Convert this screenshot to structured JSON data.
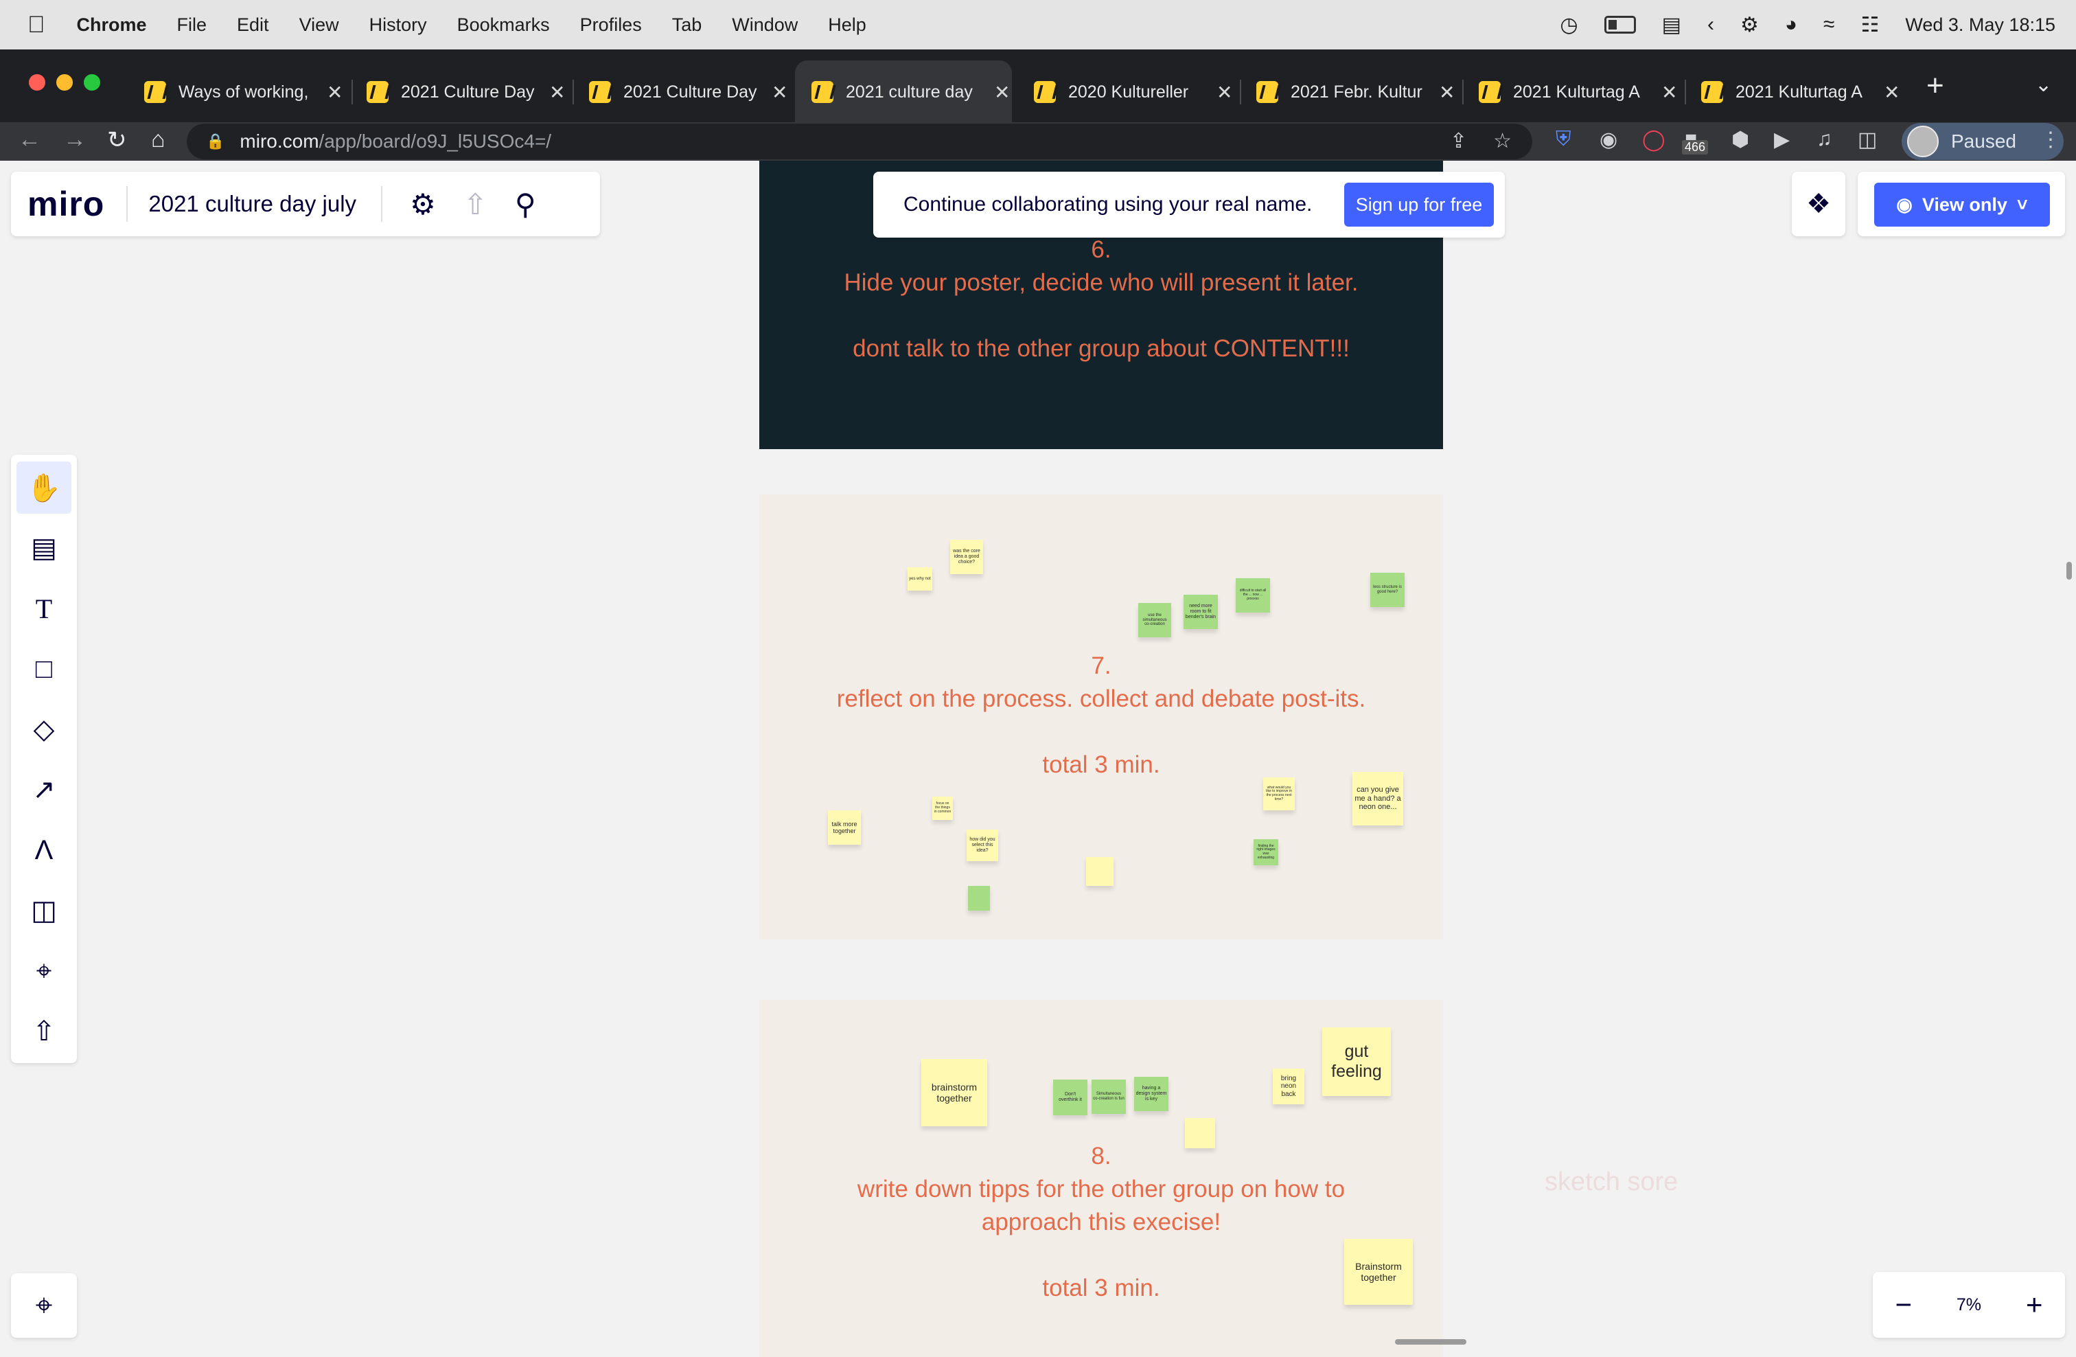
{
  "menubar": {
    "app": "Chrome",
    "items": [
      "File",
      "Edit",
      "View",
      "History",
      "Bookmarks",
      "Profiles",
      "Tab",
      "Window",
      "Help"
    ],
    "clock": "Wed 3. May  18:15"
  },
  "tabs": [
    {
      "title": "Ways of working,"
    },
    {
      "title": "2021 Culture Day"
    },
    {
      "title": "2021 Culture Day"
    },
    {
      "title": "2021 culture day"
    },
    {
      "title": "2020 Kultureller"
    },
    {
      "title": "2021 Febr. Kultur"
    },
    {
      "title": "2021 Kulturtag A"
    },
    {
      "title": "2021 Kulturtag A"
    }
  ],
  "browser": {
    "url_host": "miro.com",
    "url_path": "/app/board/o9J_l5USOc4=/",
    "extension_badge": "466",
    "profile_status": "Paused"
  },
  "miro": {
    "logo": "miro",
    "board_title": "2021 culture day july",
    "banner_message": "Continue collaborating using your real name.",
    "signup_label": "Sign up for free",
    "view_only_label": "View only",
    "zoom_level": "7%",
    "zoom_out": "−",
    "zoom_in": "+"
  },
  "icons": {
    "apple": "apple-logo-icon",
    "settings": "gear-icon",
    "share": "upload-icon",
    "search": "search-icon",
    "apps": "apps-icon",
    "eye": "eye-icon",
    "tools": [
      "hand-icon",
      "comment-icon",
      "text-icon",
      "sticky-note-icon",
      "shapes-icon",
      "arrow-icon",
      "pen-icon",
      "templates-icon",
      "frame-icon",
      "upload-icon"
    ]
  },
  "colors": {
    "accent": "#4262ff",
    "frame_dark": "#12232b",
    "frame_light": "#f3ede8",
    "frame_text": "#e46c4b",
    "sticky_yellow": "#fff9b1",
    "sticky_green": "#a6dc84"
  },
  "board": {
    "frame6": {
      "number": "6.",
      "line1": "Hide your poster, decide who will present it later.",
      "line2": "dont talk to the other group about CONTENT!!!"
    },
    "frame7": {
      "number": "7.",
      "line1": "reflect on the process. collect and debate post-its.",
      "line2": "total 3 min.",
      "stickies": [
        "was the core idea a good choice?",
        "yes why not",
        "use the simultaneous co-creation",
        "need more room to fit bender's brain",
        "difficult to start all the ... now ... process",
        "less structure is good here?",
        "talk more together",
        "focus on the things in common",
        "how did you select this idea?",
        "",
        "",
        "what would you like to improve in the process next time?",
        "can you give me a hand? a neon one...",
        "finding the right images was exhausting"
      ]
    },
    "frame8": {
      "number": "8.",
      "line1": "write down tipps for the other group on how to",
      "line2": "approach this execise!",
      "line3": "total 3 min.",
      "stickies": [
        "brainstorm together",
        "Don't overthink it",
        "Simultaneous co-creation is fun",
        "having a design system is key",
        "",
        "bring neon back",
        "gut feeling",
        "Brainstorm together"
      ]
    },
    "ghost_text": "sketch sore"
  }
}
